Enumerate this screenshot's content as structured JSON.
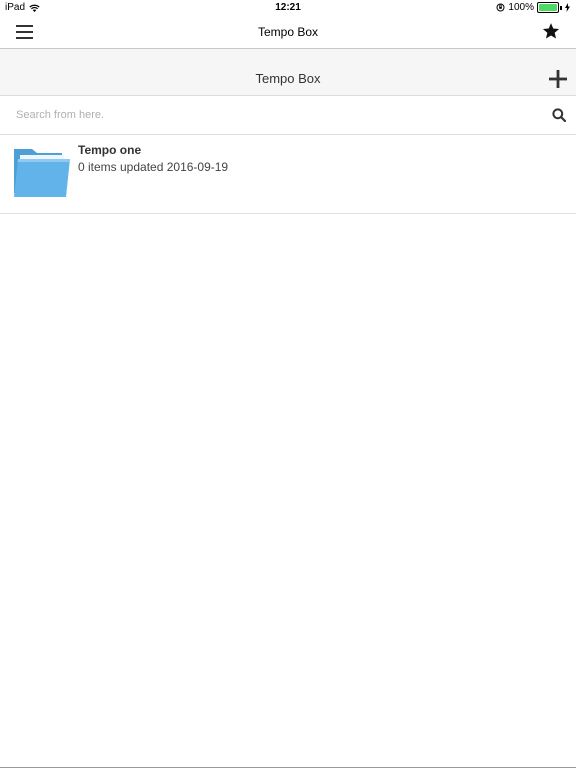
{
  "status_bar": {
    "device": "iPad",
    "time": "12:21",
    "battery": "100%",
    "battery_level": 1.0,
    "battery_color": "#4cd964"
  },
  "nav": {
    "title": "Tempo Box",
    "menu_icon": "hamburger-menu-icon",
    "favorite_icon": "star-icon"
  },
  "section": {
    "title": "Tempo Box",
    "add_icon": "plus-icon"
  },
  "search": {
    "placeholder": "Search from here.",
    "value": "",
    "icon": "search-icon"
  },
  "items": [
    {
      "title": "Tempo one",
      "subtitle": "0 items updated 2016-09-19",
      "icon": "folder-icon",
      "icon_color": "#5aaee5"
    }
  ]
}
